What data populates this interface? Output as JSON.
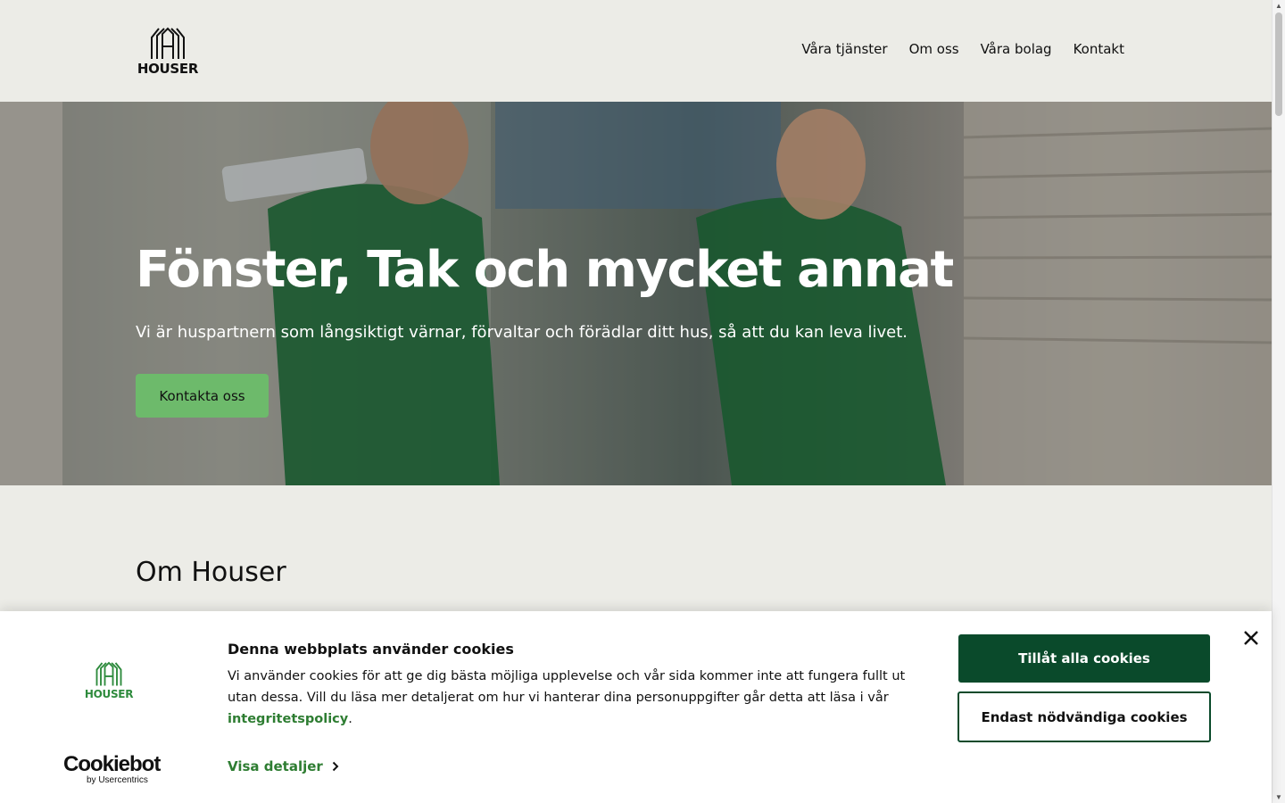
{
  "header": {
    "logo_text": "HOUSER",
    "nav": [
      "Våra tjänster",
      "Om oss",
      "Våra bolag",
      "Kontakt"
    ]
  },
  "hero": {
    "title": "Fönster, Tak och mycket annat",
    "subtitle": "Vi är huspartnern som långsiktigt värnar, förvaltar och förädlar ditt hus, så att du kan leva livet.",
    "cta": "Kontakta oss"
  },
  "about": {
    "title": "Om Houser"
  },
  "cookie_banner": {
    "logo_text": "HOUSER",
    "title": "Denna webbplats använder cookies",
    "text": "Vi använder cookies för att ge dig bästa möjliga upplevelse och vår sida kommer inte att fungera fullt ut utan dessa. Vill du läsa mer detaljerat om hur vi hanterar dina personuppgifter går detta att läsa i vår",
    "link_text": "integritetspolicy",
    "link_suffix": ".",
    "details_label": "Visa detaljer",
    "allow_all_label": "Tillåt alla cookies",
    "necessary_label": "Endast nödvändiga cookies",
    "brand_name": "Cookiebot",
    "brand_by": "by Usercentrics"
  },
  "colors": {
    "page_bg": "#ecece7",
    "cta_green": "#6dba6b",
    "dark_green": "#0a4a2b",
    "link_green": "#2e7d32"
  },
  "icons": [
    "houser-logo-icon",
    "close-icon",
    "chevron-right-icon"
  ]
}
